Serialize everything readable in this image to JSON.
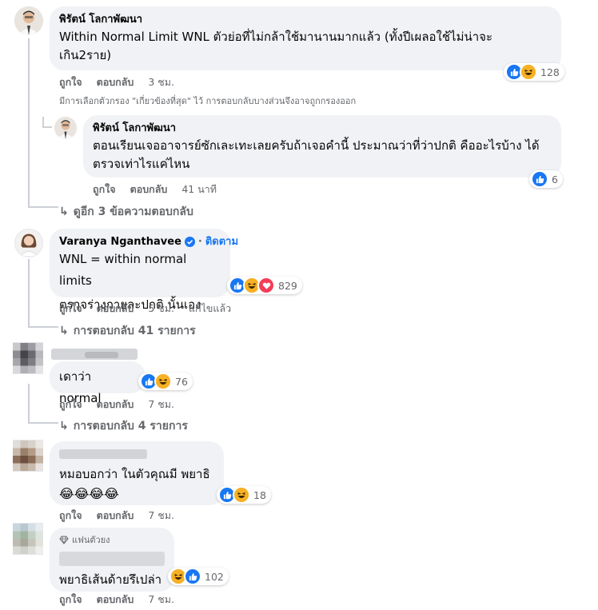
{
  "comments": [
    {
      "author": "พิรัตน์ โลกาพัฒนา",
      "lines": [
        "Within Normal Limit WNL ตัวย่อที่ไม่กล้าใช้มานานมากแล้ว (ทั้งปีเผลอใช้ไม่น่าจะ",
        "เกิน2ราย)"
      ],
      "like": "ถูกใจ",
      "reply": "ตอบกลับ",
      "time": "3 ชม.",
      "reaction_count": "128",
      "reactions": [
        "like",
        "haha"
      ]
    },
    {
      "author": "พิรัตน์ โลกาพัฒนา",
      "lines": [
        "ตอนเรียนเจออาจารย์ซักเละเทะเลยครับถ้าเจอคำนี้ ประมาณว่าที่ว่าปกติ คืออะไรบ้าง ได้",
        "ตรวจเท่าไรแค่ไหน"
      ],
      "like": "ถูกใจ",
      "reply": "ตอบกลับ",
      "time": "41 นาที",
      "reaction_count": "6",
      "reactions": [
        "like"
      ]
    },
    {
      "author": "Varanya Nganthavee",
      "follow": "ติดตาม",
      "lines": [
        "WNL = within normal limits",
        "ตรวจร่างกายละปกติ นั้นเอง"
      ],
      "like": "ถูกใจ",
      "reply": "ตอบกลับ",
      "time": "5 ชม.",
      "edited": "แก้ไขแล้ว",
      "reaction_count": "829",
      "reactions": [
        "like",
        "haha",
        "love"
      ]
    },
    {
      "lines": [
        "เดาว่า normal"
      ],
      "like": "ถูกใจ",
      "reply": "ตอบกลับ",
      "time": "7 ชม.",
      "reaction_count": "76",
      "reactions": [
        "like",
        "haha"
      ]
    },
    {
      "lines": [
        "หมอบอกว่า ในตัวคุณมี พยาธิ",
        "😂😂😂😂"
      ],
      "like": "ถูกใจ",
      "reply": "ตอบกลับ",
      "time": "7 ชม.",
      "reaction_count": "18",
      "reactions": [
        "like",
        "haha"
      ]
    },
    {
      "badge": "แฟนตัวยง",
      "lines": [
        "พยาธิเส้นด้ายรึเปล่า"
      ],
      "like": "ถูกใจ",
      "reply": "ตอบกลับ",
      "time": "7 ชม.",
      "reaction_count": "102",
      "reactions": [
        "haha",
        "like"
      ]
    }
  ],
  "filter_note": "มีการเลือกตัวกรอง \"เกี่ยวข้องที่สุด\" ไว้ การตอบกลับบางส่วนจึงอาจถูกกรองออก",
  "more_replies": [
    "ดูอีก 3 ข้อความตอบกลับ",
    "การตอบกลับ 41 รายการ",
    "การตอบกลับ 4 รายการ"
  ],
  "colors": {
    "like": "#1877f2",
    "haha": "#f7b125",
    "love": "#f33e58",
    "verified": "#1877f2",
    "follow": "#1877f2"
  }
}
